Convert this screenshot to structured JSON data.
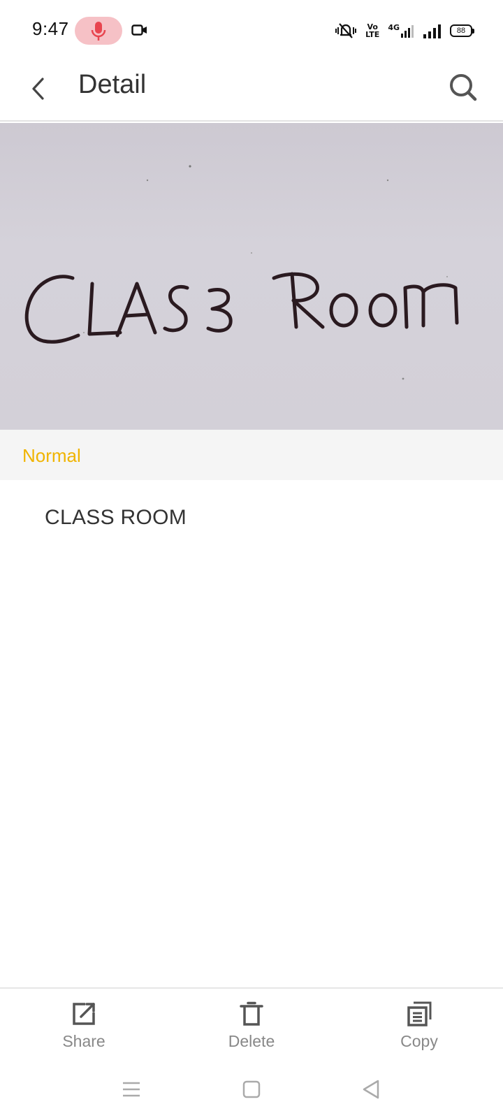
{
  "status_bar": {
    "time": "9:47",
    "volte_line1": "Vo",
    "volte_line2": "LTE",
    "network": "4G",
    "battery": "88"
  },
  "app_bar": {
    "title": "Detail"
  },
  "photo": {
    "handwriting": "CLASS ROOM"
  },
  "category": {
    "label": "Normal",
    "color": "#f0b400"
  },
  "result": {
    "text": "CLASS ROOM"
  },
  "toolbar": {
    "share_label": "Share",
    "delete_label": "Delete",
    "copy_label": "Copy"
  },
  "icons": {
    "back": "chevron-left-icon",
    "search": "search-icon",
    "share": "share-icon",
    "delete": "trash-icon",
    "copy": "copy-icon"
  }
}
